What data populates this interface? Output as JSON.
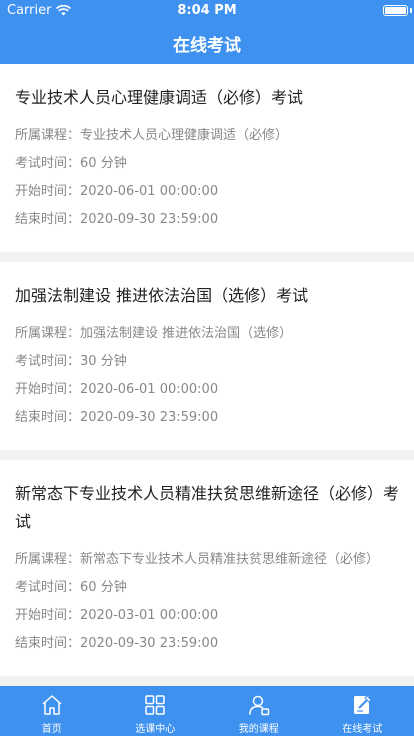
{
  "status_bar": {
    "carrier": "Carrier",
    "time": "8:04 PM",
    "battery_level": 1.0
  },
  "nav": {
    "title": "在线考试"
  },
  "labels": {
    "course": "所属课程：",
    "duration": "考试时间：",
    "start": "开始时间：",
    "end": "结束时间："
  },
  "exams": [
    {
      "title": "专业技术人员心理健康调适（必修）考试",
      "course": "专业技术人员心理健康调适（必修）",
      "duration": "60 分钟",
      "start": "2020-06-01 00:00:00",
      "end": "2020-09-30 23:59:00"
    },
    {
      "title": "加强法制建设 推进依法治国（选修）考试",
      "course": "加强法制建设 推进依法治国（选修）",
      "duration": "30 分钟",
      "start": "2020-06-01 00:00:00",
      "end": "2020-09-30 23:59:00"
    },
    {
      "title": "新常态下专业技术人员精准扶贫思维新途径（必修）考试",
      "course": "新常态下专业技术人员精准扶贫思维新途径（必修）",
      "duration": "60 分钟",
      "start": "2020-03-01 00:00:00",
      "end": "2020-09-30 23:59:00"
    }
  ],
  "tabs": [
    {
      "label": "首页",
      "icon": "home-icon"
    },
    {
      "label": "选课中心",
      "icon": "grid-icon"
    },
    {
      "label": "我的课程",
      "icon": "user-icon"
    },
    {
      "label": "在线考试",
      "icon": "exam-icon",
      "active": true
    }
  ],
  "colors": {
    "primary": "#3f91f0",
    "text": "#222222",
    "secondary": "#888888",
    "background": "#f2f2f2"
  }
}
